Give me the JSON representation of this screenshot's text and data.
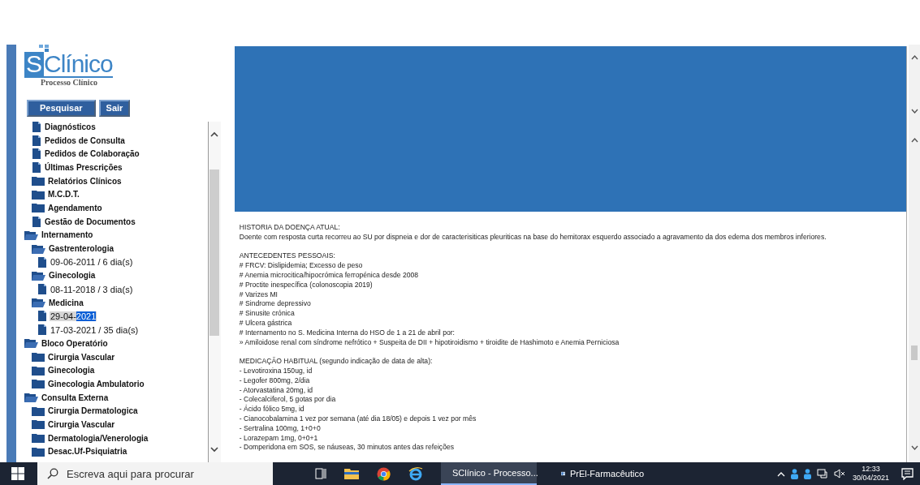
{
  "app": {
    "logo_letter": "S",
    "logo_name": "Clínico",
    "logo_subtitle": "Processo Clínico"
  },
  "buttons": [
    "Pesquisar",
    "Sair"
  ],
  "tree": [
    {
      "children": [
        {
          "label": "Diagnósticos",
          "kind": "document",
          "selected": false
        },
        {
          "label": "Pedidos de Consulta",
          "kind": "document",
          "selected": false
        },
        {
          "label": "Pedidos de Colaboração",
          "kind": "document",
          "selected": false
        },
        {
          "label": "Últimas Prescrições",
          "kind": "document",
          "selected": false
        },
        {
          "label": "Relatórios Clínicos",
          "kind": "folder",
          "selected": false
        },
        {
          "label": "M.C.D.T.",
          "kind": "folder",
          "selected": false
        },
        {
          "label": "Agendamento",
          "kind": "folder",
          "selected": false
        },
        {
          "label": "Gestão de Documentos",
          "kind": "document",
          "selected": false
        }
      ]
    },
    {
      "label": "Internamento",
      "kind": "folder-open",
      "selected": false,
      "children": [
        {
          "label": "Gastrenterologia",
          "kind": "folder-open",
          "selected": false,
          "children": [
            {
              "label": "09-06-2011 / 6 dia(s)",
              "kind": "document",
              "selected": false
            }
          ]
        },
        {
          "label": "Ginecologia",
          "kind": "folder-open",
          "selected": false,
          "children": [
            {
              "label": "08-11-2018 / 3 dia(s)",
              "kind": "document",
              "selected": false
            }
          ]
        },
        {
          "label": "Medicina",
          "kind": "folder-open",
          "selected": false,
          "children": [
            {
              "label": "29-04-",
              "highlighted": "2021",
              "kind": "document",
              "selected": true
            },
            {
              "label": "17-03-2021 / 35 dia(s)",
              "kind": "document",
              "selected": false
            }
          ]
        }
      ]
    },
    {
      "label": "Bloco Operatório",
      "kind": "folder-open",
      "selected": false,
      "children": [
        {
          "label": "Cirurgia Vascular",
          "kind": "folder",
          "selected": false
        },
        {
          "label": "Ginecologia",
          "kind": "folder",
          "selected": false
        },
        {
          "label": "Ginecologia Ambulatorio",
          "kind": "folder",
          "selected": false
        }
      ]
    },
    {
      "label": "Consulta Externa",
      "kind": "folder-open",
      "selected": false,
      "children": [
        {
          "label": "Cirurgia Dermatologica",
          "kind": "folder",
          "selected": false
        },
        {
          "label": "Cirurgia Vascular",
          "kind": "folder",
          "selected": false
        },
        {
          "label": "Dermatologia/Venerologia",
          "kind": "folder",
          "selected": false
        },
        {
          "label": "Desac.Uf-Psiquiatria",
          "kind": "folder",
          "selected": false
        }
      ]
    }
  ],
  "document": {
    "sections": [
      {
        "heading": "HISTORIA DA DOENÇA ATUAL:",
        "lines": [
          "Doente com resposta curta recorreu ao SU por dispneia e dor de caracterisiticas pleuriticas na base do hemitorax esquerdo associado a agravamento da dos edema dos membros inferiores."
        ]
      },
      {
        "heading": "ANTECEDENTES PESSOAIS:",
        "lines": [
          "# FRCV: Dislipidemia; Excesso de peso",
          "# Anemia microcitica/hipocrómica ferropénica desde 2008",
          "# Proctite inespecífica (colonoscopia 2019)",
          "# Varizes MI",
          "# Sindrome depressivo",
          "# Sinusite crónica",
          "# Ulcera gástrica",
          "# Internamento no S. Medicina Interna do HSO de 1 a 21 de abril por:",
          "» Amiloidose renal com síndrome nefrótico + Suspeita de DII + hipotiroidismo + tiroidite de Hashimoto e Anemia Perniciosa"
        ]
      },
      {
        "heading": "MEDICAÇÃO HABITUAL (segundo indicação de data de alta):",
        "lines": [
          "- Levotiroxina 150ug, id",
          "- Legofer 800mg, 2/dia",
          "- Atorvastatina 20mg, id",
          "- Colecalciferol, 5 gotas por dia",
          "- Ácido fólico 5mg, id",
          "- Cianocobalamina 1 vez por semana (até dia 18/05) e depois 1 vez por mês",
          "- Sertralina 100mg, 1+0+0",
          "- Lorazepam 1mg, 0+0+1",
          "- Domperidona em SOS, se náuseas, 30 minutos antes das refeições"
        ]
      }
    ]
  },
  "taskbar": {
    "search": {
      "placeholder": "Escreva aqui para procurar"
    },
    "apps": [
      {
        "label": "SClínico - Processo...",
        "kind": "browser",
        "selected": true
      },
      {
        "label": "PrEl-Farmacêutico",
        "kind": "app",
        "selected": false
      }
    ],
    "time": "12:33",
    "date": "30/04/2021"
  }
}
